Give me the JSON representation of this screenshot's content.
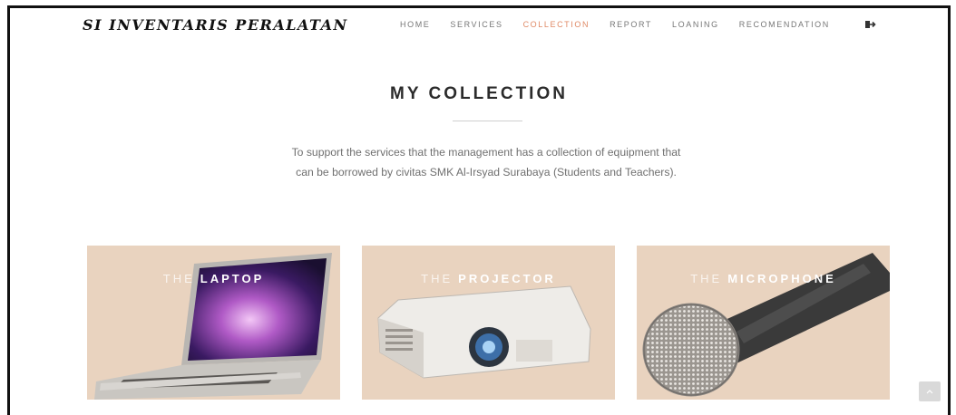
{
  "brand": "SI INVENTARIS PERALATAN",
  "nav": {
    "home": "HOME",
    "services": "SERVICES",
    "collection": "COLLECTION",
    "report": "REPORT",
    "loaning": "LOANING",
    "recomendation": "RECOMENDATION"
  },
  "icons": {
    "logout": "sign-out-icon",
    "scroll_top": "chevron-up-icon"
  },
  "colors": {
    "active_nav": "#e08a66",
    "card_bg": "#e9d3bf"
  },
  "section": {
    "title": "MY COLLECTION",
    "description": "To support the services that the management has a collection of equipment that can be borrowed by civitas SMK Al-Irsyad Surabaya (Students and Teachers)."
  },
  "cards": [
    {
      "prefix": "THE",
      "name": "LAPTOP"
    },
    {
      "prefix": "THE",
      "name": "PROJECTOR"
    },
    {
      "prefix": "THE",
      "name": "MICROPHONE"
    }
  ]
}
